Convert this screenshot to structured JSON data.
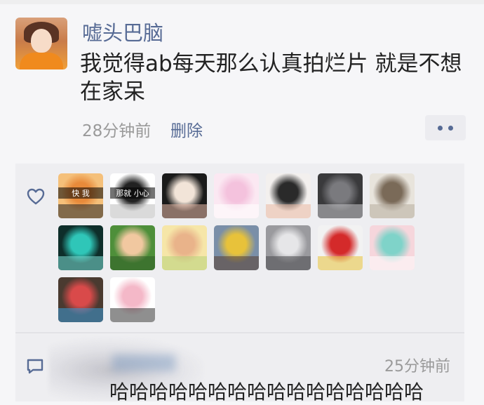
{
  "post": {
    "username": "嘘头巴脑",
    "text": "我觉得ab每天那么认真拍烂片 就是不想在家呆",
    "time": "28分钟前",
    "delete_label": "删除"
  },
  "likes": {
    "avatars": [
      {
        "name": "anime-girl-sunglasses",
        "colors": [
          "#f5c07a",
          "#e88a3a",
          "#222222"
        ],
        "text": "快 我"
      },
      {
        "name": "panda-meme",
        "colors": [
          "#ffffff",
          "#222222",
          "#bbbbbb"
        ],
        "text": "那就 小心"
      },
      {
        "name": "woman-with-flower",
        "colors": [
          "#1a1a1a",
          "#f2e4d8",
          "#e8b9a8"
        ],
        "text": ""
      },
      {
        "name": "bunny-cartoon",
        "colors": [
          "#fbe8f2",
          "#f4c2dd",
          "#ffffff"
        ],
        "text": ""
      },
      {
        "name": "couple-illustration",
        "colors": [
          "#f3f0ee",
          "#2a2a2a",
          "#e9b9a4"
        ],
        "text": ""
      },
      {
        "name": "dark-portrait",
        "colors": [
          "#3a3a3c",
          "#7a7a7e",
          "#c9c9cc"
        ],
        "text": ""
      },
      {
        "name": "cat-photo",
        "colors": [
          "#e8e4dc",
          "#7a6a58",
          "#b7ad9e"
        ],
        "text": ""
      },
      {
        "name": "green-hair-figure",
        "colors": [
          "#0e2e2a",
          "#2fc6b8",
          "#7ee0d6"
        ],
        "text": ""
      },
      {
        "name": "boy-green-field",
        "colors": [
          "#4e8f3a",
          "#f1c8a0",
          "#2f5e26"
        ],
        "text": ""
      },
      {
        "name": "anime-kid",
        "colors": [
          "#f6e6a8",
          "#e9b38a",
          "#b7d27a"
        ],
        "text": ""
      },
      {
        "name": "man-yellow-shirt",
        "colors": [
          "#7a8fa8",
          "#e8c23a",
          "#5a4030"
        ],
        "text": ""
      },
      {
        "name": "cat-in-bowl",
        "colors": [
          "#9a9a9e",
          "#e6e6e8",
          "#4a4a4e"
        ],
        "text": ""
      },
      {
        "name": "pug-red-hood",
        "colors": [
          "#f2f2f2",
          "#d42a2a",
          "#e8c23a"
        ],
        "text": ""
      },
      {
        "name": "bear-scooter",
        "colors": [
          "#f6d6dc",
          "#7fd3c9",
          "#ffffff"
        ],
        "text": ""
      },
      {
        "name": "man-with-flowers",
        "colors": [
          "#4a3a30",
          "#d94a4a",
          "#3a9ad9"
        ],
        "text": ""
      },
      {
        "name": "white-bunny-sketch",
        "colors": [
          "#ffffff",
          "#f4b8c8",
          "#333333"
        ],
        "text": ""
      }
    ]
  },
  "comment": {
    "time": "25分钟前",
    "text": "哈哈哈哈哈哈哈哈哈哈哈哈哈哈哈哈"
  },
  "accent_color": "#576b95"
}
